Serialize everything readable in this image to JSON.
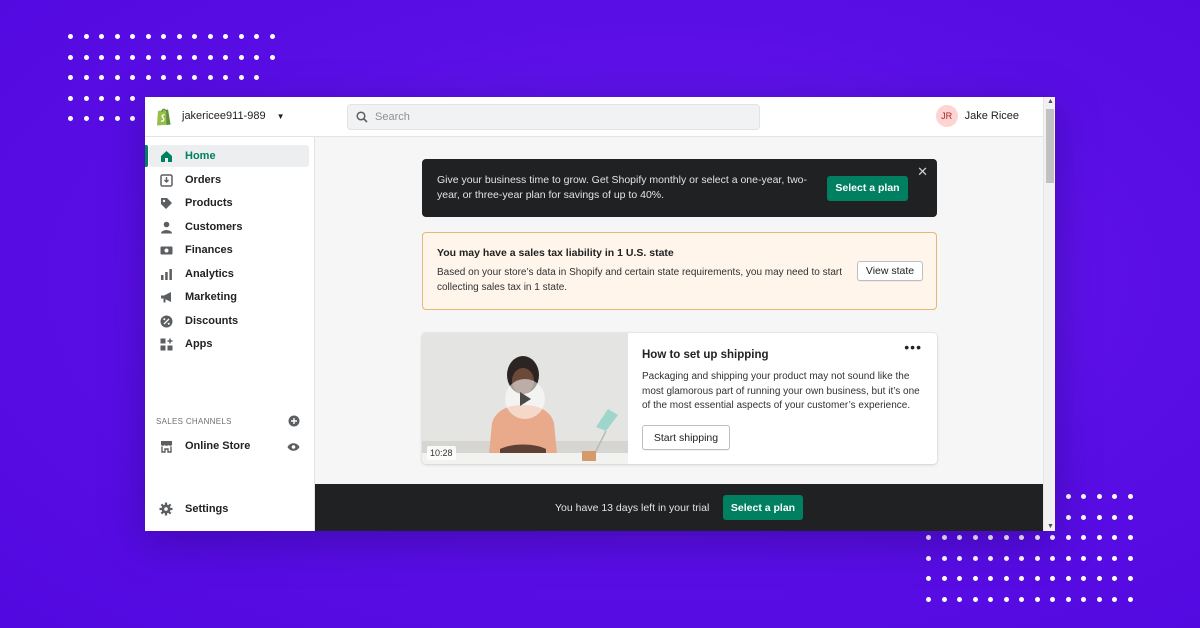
{
  "header": {
    "store_name": "jakericee911-989",
    "search_placeholder": "Search",
    "user_initials": "JR",
    "user_name": "Jake Ricee"
  },
  "sidebar": {
    "items": [
      {
        "label": "Home",
        "icon": "home-icon",
        "active": true
      },
      {
        "label": "Orders",
        "icon": "orders-icon"
      },
      {
        "label": "Products",
        "icon": "tag-icon"
      },
      {
        "label": "Customers",
        "icon": "person-icon"
      },
      {
        "label": "Finances",
        "icon": "finances-icon"
      },
      {
        "label": "Analytics",
        "icon": "bar-chart-icon"
      },
      {
        "label": "Marketing",
        "icon": "megaphone-icon"
      },
      {
        "label": "Discounts",
        "icon": "discount-icon"
      },
      {
        "label": "Apps",
        "icon": "apps-icon"
      }
    ],
    "sales_channels_label": "SALES CHANNELS",
    "online_store_label": "Online Store",
    "settings_label": "Settings"
  },
  "plan_banner": {
    "text": "Give your business time to grow. Get Shopify monthly or select a one-year, two-year, or three-year plan for savings of up to 40%.",
    "button": "Select a plan"
  },
  "tax_banner": {
    "title": "You may have a sales tax liability in 1 U.S. state",
    "body": "Based on your store’s data in Shopify and certain state requirements, you may need to start collecting sales tax in 1 state.",
    "button": "View state"
  },
  "shipping_card": {
    "title": "How to set up shipping",
    "body": "Packaging and shipping your product may not sound like the most glamorous part of running your own business, but it’s one of the most essential aspects of your customer’s experience.",
    "button": "Start shipping",
    "duration": "10:28"
  },
  "trial_bar": {
    "text": "You have 13 days left in your trial",
    "button": "Select a plan"
  },
  "colors": {
    "background": "#5a0ee6",
    "accent": "#008060",
    "dark": "#202123",
    "warning_bg": "#fff5ea"
  }
}
